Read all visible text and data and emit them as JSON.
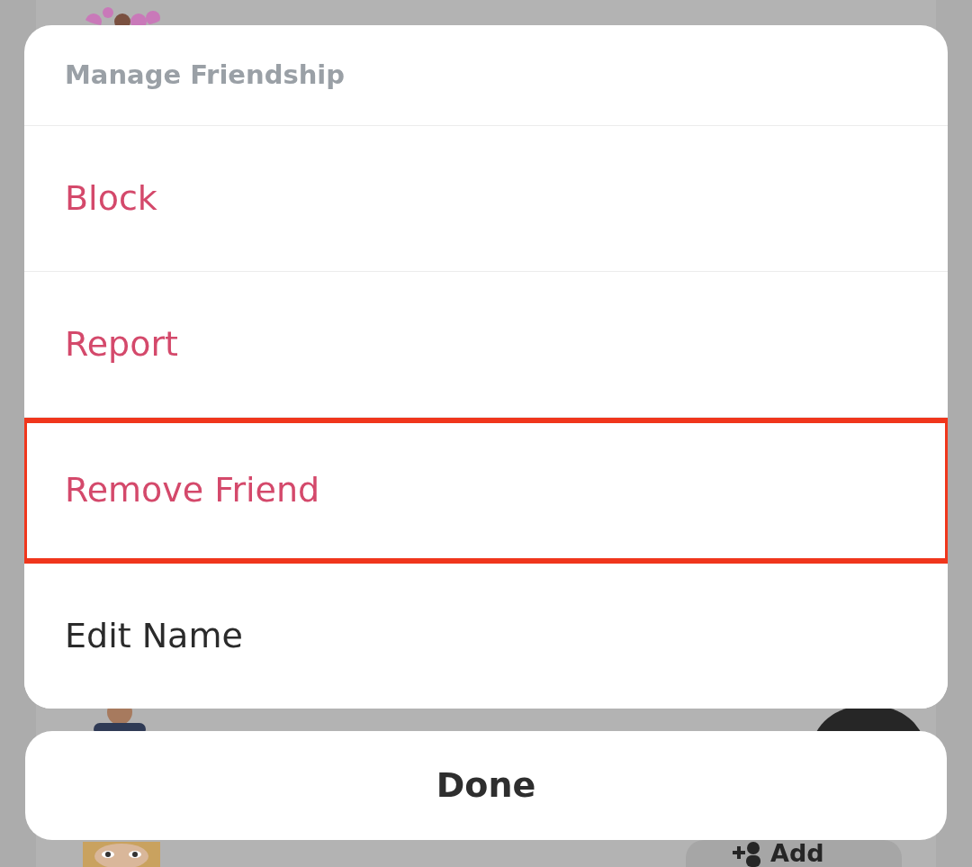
{
  "sheet": {
    "title": "Manage Friendship",
    "items": [
      {
        "label": "Block",
        "kind": "destructive",
        "highlighted": false
      },
      {
        "label": "Report",
        "kind": "destructive",
        "highlighted": false
      },
      {
        "label": "Remove Friend",
        "kind": "destructive",
        "highlighted": true
      },
      {
        "label": "Edit Name",
        "kind": "normal",
        "highlighted": false
      }
    ]
  },
  "done_button": {
    "label": "Done"
  },
  "background": {
    "add_button": {
      "label": "Add"
    }
  }
}
